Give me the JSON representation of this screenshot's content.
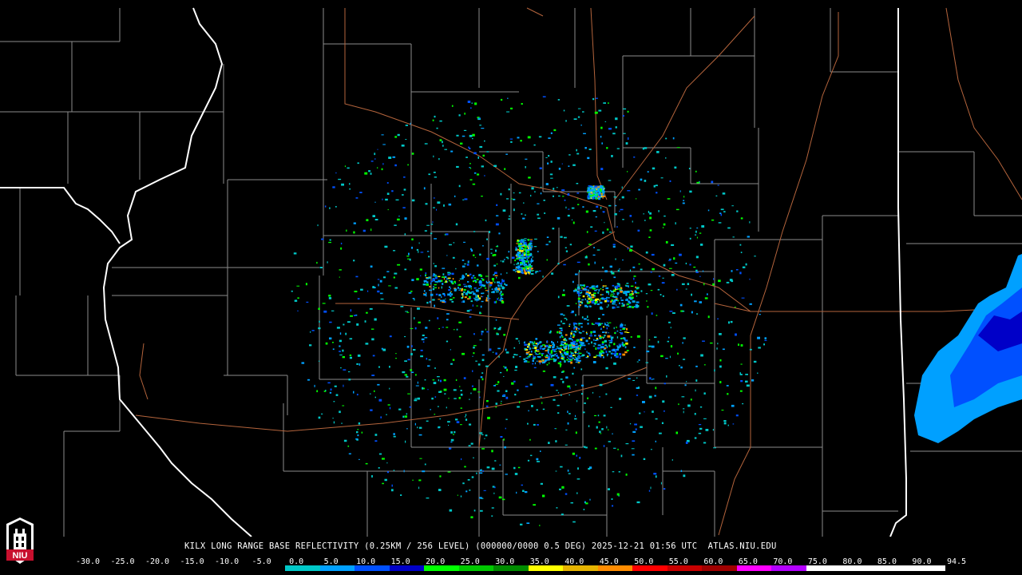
{
  "caption": {
    "product": "KILX LONG RANGE BASE REFLECTIVITY",
    "resolution": "(0.25KM / 256 LEVEL)",
    "volume": "(000000/0000 0.5 DEG)",
    "timestamp": "2025-12-21 01:56 UTC",
    "site": "ATLAS.NIU.EDU"
  },
  "colorbar": {
    "labels": [
      "-30.0",
      "-25.0",
      "-20.0",
      "-15.0",
      "-10.0",
      "-5.0",
      "0.0",
      "5.0",
      "10.0",
      "15.0",
      "20.0",
      "25.0",
      "30.0",
      "35.0",
      "40.0",
      "45.0",
      "50.0",
      "55.0",
      "60.0",
      "65.0",
      "70.0",
      "75.0",
      "80.0",
      "85.0",
      "90.0",
      "94.5"
    ],
    "colors": [
      "#000000",
      "#000000",
      "#000000",
      "#000000",
      "#000000",
      "#000000",
      "#00c8c8",
      "#00a0ff",
      "#0050ff",
      "#0000c8",
      "#00ff00",
      "#00c800",
      "#008c00",
      "#ffff00",
      "#e6b400",
      "#ff8c00",
      "#ff0000",
      "#c80000",
      "#a00000",
      "#ff00ff",
      "#b400ff",
      "#ffffff",
      "#ffffff",
      "#ffffff",
      "#ffffff"
    ]
  },
  "logo": {
    "text": "NIU",
    "color": "#c8102e"
  },
  "map": {
    "background": "#000000",
    "county_line_color": "#8c8c8c",
    "state_line_color": "#ffffff",
    "highway_color": "#b4643c",
    "radar_site": "KILX"
  }
}
